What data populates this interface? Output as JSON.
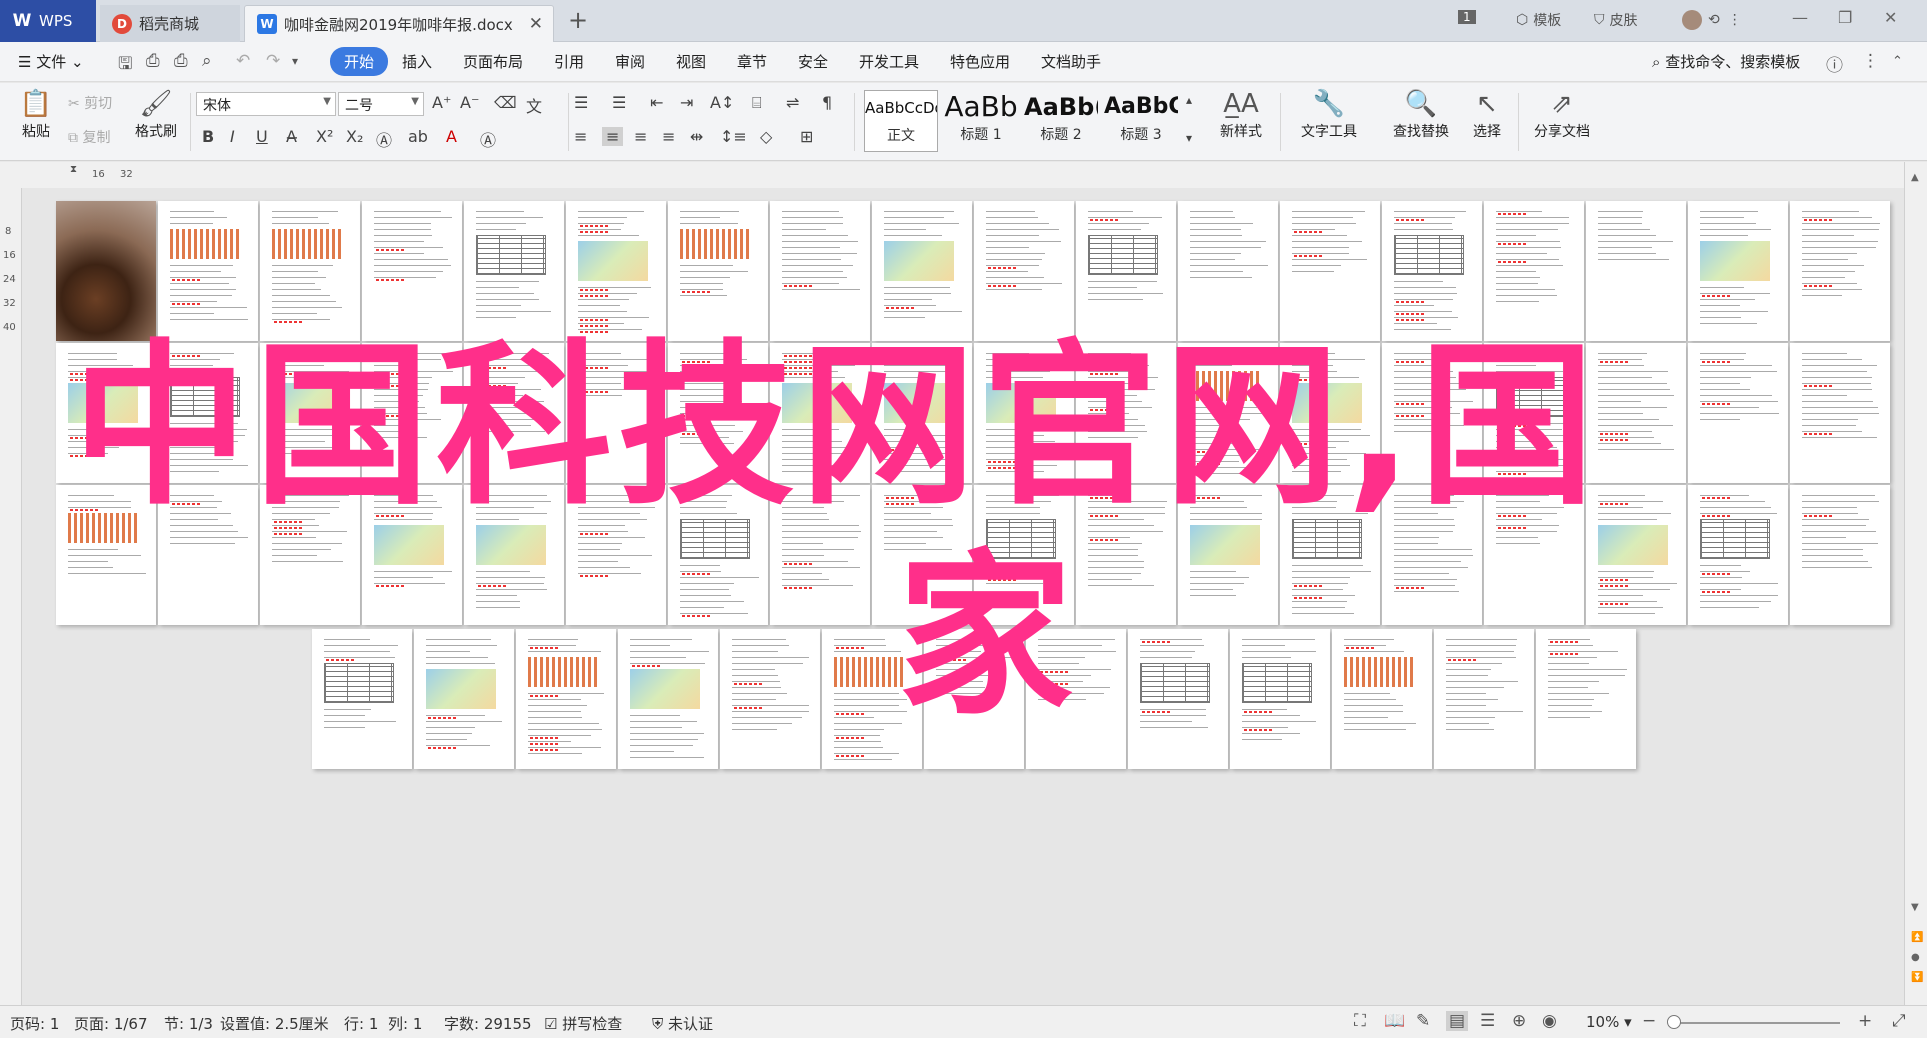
{
  "titlebar": {
    "tabs": [
      {
        "label": "WPS",
        "icon": "wps-logo-icon"
      },
      {
        "label": "稻壳商城",
        "icon": "docer-store-icon"
      },
      {
        "label": "咖啡金融网2019年咖啡年报.docx",
        "icon": "word-doc-icon"
      }
    ],
    "page_badge": "1",
    "template_label": "模板",
    "skin_label": "皮肤"
  },
  "menubar": {
    "file_label": "文件",
    "items": [
      "开始",
      "插入",
      "页面布局",
      "引用",
      "审阅",
      "视图",
      "章节",
      "安全",
      "开发工具",
      "特色应用",
      "文档助手"
    ],
    "search_label": "查找命令、搜索模板"
  },
  "ribbon": {
    "paste": "粘贴",
    "cut": "剪切",
    "copy": "复制",
    "format_painter": "格式刷",
    "font_name": "宋体",
    "font_size": "二号",
    "styles": [
      {
        "sample": "AaBbCcDd",
        "label": "正文"
      },
      {
        "sample": "AaBb",
        "label": "标题 1"
      },
      {
        "sample": "AaBb(",
        "label": "标题 2"
      },
      {
        "sample": "AaBbC",
        "label": "标题 3"
      }
    ],
    "new_style": "新样式",
    "text_tools": "文字工具",
    "find_replace": "查找替换",
    "select": "选择",
    "share_doc": "分享文档"
  },
  "ruler": {
    "top_marks": [
      "16",
      "32"
    ],
    "left_marks": [
      "8",
      "16",
      "24",
      "32",
      "40"
    ]
  },
  "overlay": {
    "line1": "中国科技网官网,国",
    "line2": "家"
  },
  "statusbar": {
    "page_no": "页码: 1",
    "page": "页面: 1/67",
    "section": "节: 1/3",
    "setting": "设置值: 2.5厘米",
    "row": "行: 1",
    "col": "列: 1",
    "wordcount": "字数: 29155",
    "spellcheck": "拼写检查",
    "auth": "未认证",
    "zoom": "10%"
  },
  "colors": {
    "accent": "#3b7ae0",
    "overlay_text": "#ff2f8a",
    "wps_tab": "#2d4ea5"
  }
}
